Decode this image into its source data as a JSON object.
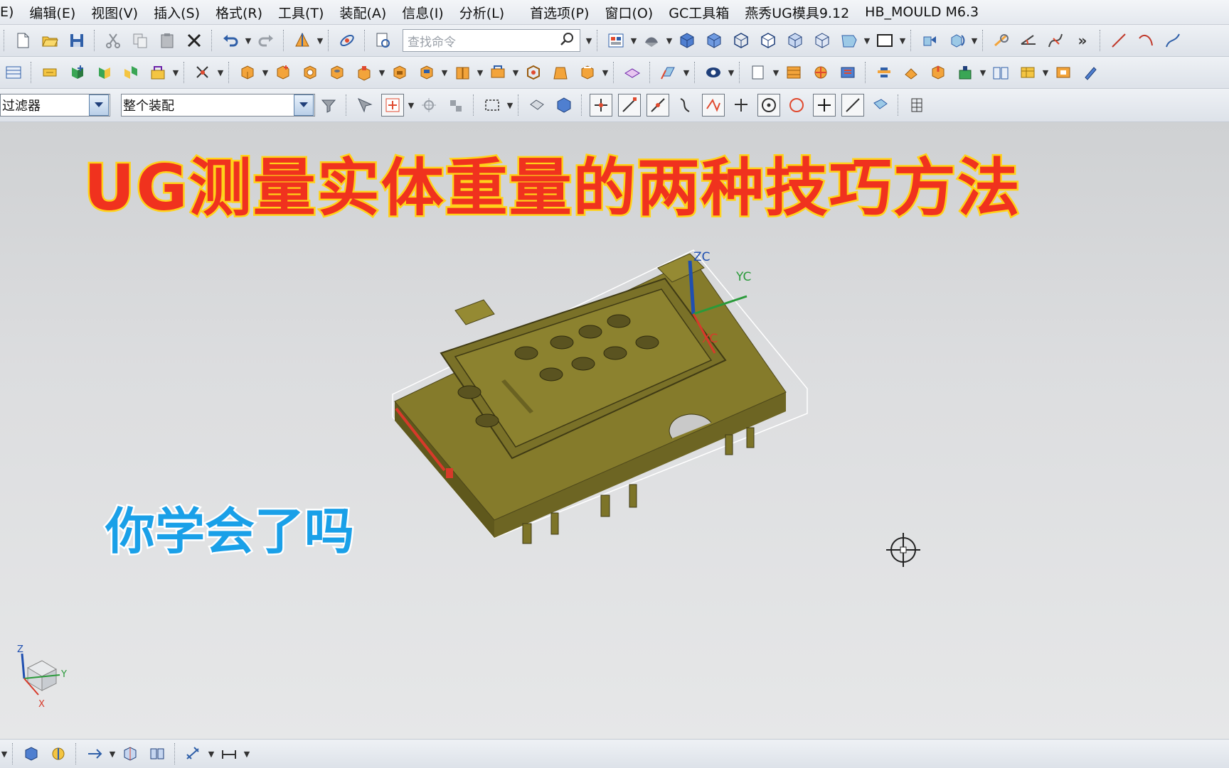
{
  "menu": {
    "items": [
      "E)",
      "编辑(E)",
      "视图(V)",
      "插入(S)",
      "格式(R)",
      "工具(T)",
      "装配(A)",
      "信息(I)",
      "分析(L)",
      "首选项(P)",
      "窗口(O)",
      "GC工具箱",
      "燕秀UG模具9.12",
      "HB_MOULD M6.3"
    ]
  },
  "search": {
    "placeholder": "查找命令"
  },
  "filter": {
    "type_filter": "过滤器",
    "scope": "整个装配"
  },
  "overlay": {
    "title": "UG测量实体重量的两种技巧方法",
    "subtitle": "你学会了吗"
  },
  "csys": {
    "zc": "ZC",
    "yc": "YC",
    "xc": "XC"
  },
  "view_triad": {
    "z": "Z",
    "y": "Y",
    "x": "X"
  },
  "colors": {
    "model_body": "#7d7428",
    "title_fill": "#f0321e",
    "title_outline": "#ffd21a",
    "subtitle_fill": "#1aa0e8"
  }
}
